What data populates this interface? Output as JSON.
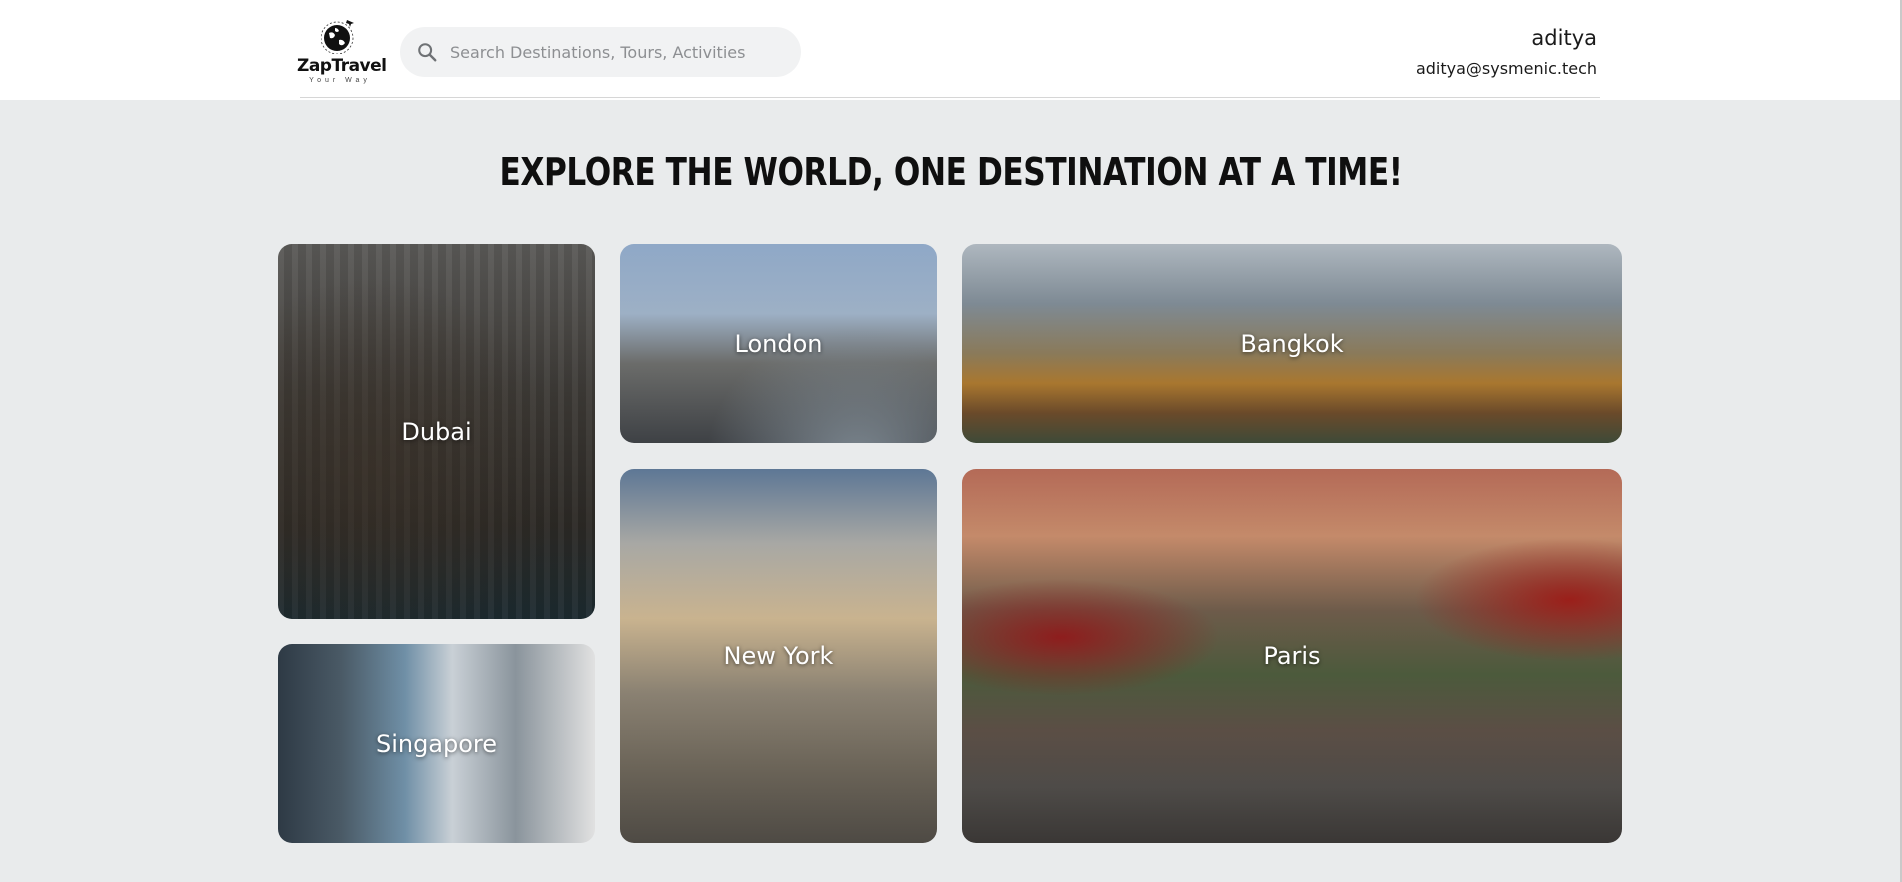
{
  "header": {
    "logo": {
      "name": "ZapTravel",
      "tagline": "Your Way"
    },
    "search": {
      "placeholder": "Search Destinations, Tours, Activities",
      "value": ""
    },
    "user": {
      "name": "aditya",
      "email": "aditya@sysmenic.tech"
    }
  },
  "main": {
    "headline": "EXPLORE THE WORLD, ONE DESTINATION AT A TIME!",
    "destinations": [
      {
        "label": "Dubai"
      },
      {
        "label": "London"
      },
      {
        "label": "Bangkok"
      },
      {
        "label": "Singapore"
      },
      {
        "label": "New York"
      },
      {
        "label": "Paris"
      }
    ]
  },
  "colors": {
    "header_bg": "#ffffff",
    "page_bg": "#e9ebec",
    "search_bg": "#f1f2f3",
    "headline": "#0f0f0f",
    "card_label": "#ffffff"
  }
}
